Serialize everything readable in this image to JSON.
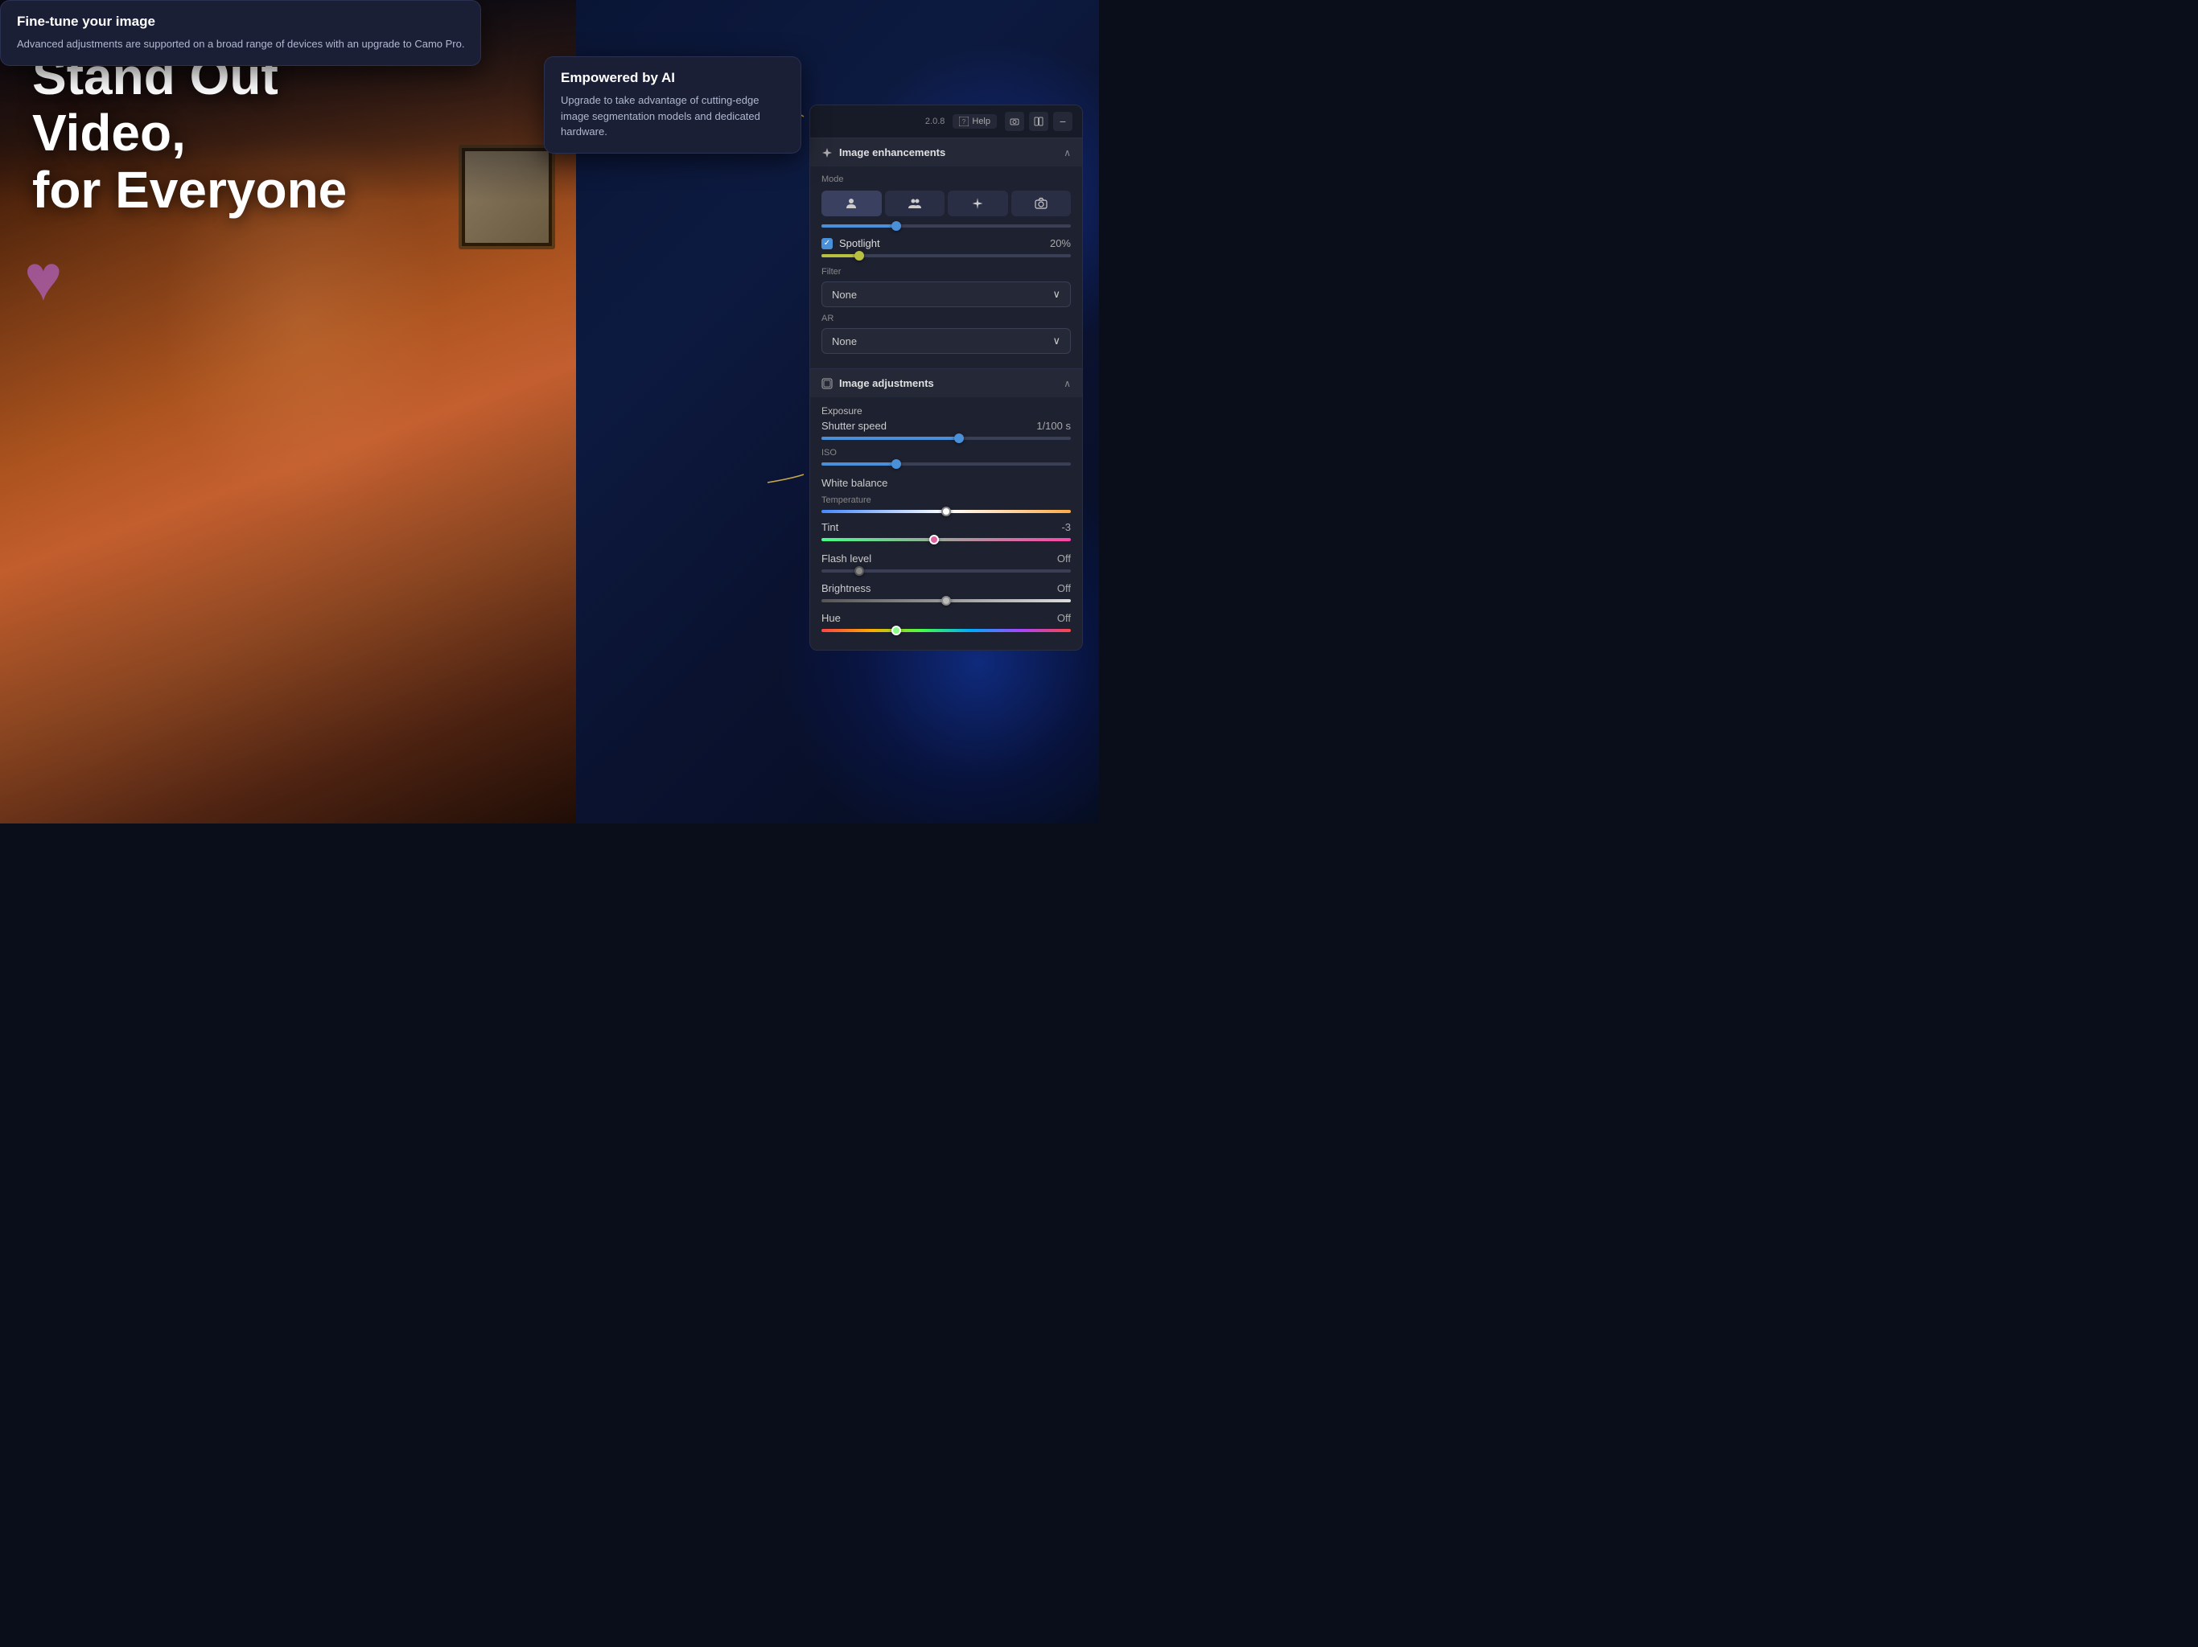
{
  "app": {
    "version": "2.0.8",
    "help_label": "Help"
  },
  "headline": {
    "line1": "Stand Out Video,",
    "line2": "for Everyone"
  },
  "tooltip_ai": {
    "title": "Empowered by AI",
    "text": "Upgrade to take advantage of cutting-edge image segmentation models and dedicated hardware."
  },
  "tooltip_finetune": {
    "title": "Fine-tune your image",
    "text": "Advanced adjustments are supported on a broad range of devices with an upgrade to Camo Pro."
  },
  "image_enhancements": {
    "label": "Image enhancements",
    "mode_label": "Mode",
    "mode_buttons": [
      {
        "icon": "👤",
        "label": "person"
      },
      {
        "icon": "👥",
        "label": "person-group"
      },
      {
        "icon": "✨",
        "label": "enhance"
      },
      {
        "icon": "📷",
        "label": "camera"
      }
    ],
    "spotlight": {
      "label": "Spotlight",
      "value": "20%",
      "checked": true
    },
    "slider_position_pct": 30,
    "spotlight_slider_pct": 15,
    "filter": {
      "label": "Filter",
      "value": "None"
    },
    "ar": {
      "label": "AR",
      "value": "None"
    }
  },
  "image_adjustments": {
    "label": "Image adjustments",
    "exposure_label": "Exposure",
    "shutter_speed": {
      "label": "Shutter speed",
      "value": "1/100 s",
      "slider_pct": 55
    },
    "iso": {
      "label": "ISO",
      "slider_pct": 30
    },
    "white_balance": {
      "label": "White balance",
      "temperature": {
        "label": "Temperature",
        "slider_pct": 50
      },
      "tint": {
        "label": "Tint",
        "value": "-3",
        "slider_pct": 45
      }
    },
    "flash_level": {
      "label": "Flash level",
      "value": "Off",
      "slider_pct": 15
    },
    "brightness": {
      "label": "Brightness",
      "value": "Off",
      "slider_pct": 50
    },
    "hue": {
      "label": "Hue",
      "value": "Off",
      "slider_pct": 30
    }
  },
  "icons": {
    "chevron_up": "∧",
    "chevron_down": "∨",
    "check": "✓",
    "layout": "⊞",
    "camera": "⬛",
    "minimize": "−",
    "sparkle": "✦",
    "image_adj": "⊡"
  }
}
